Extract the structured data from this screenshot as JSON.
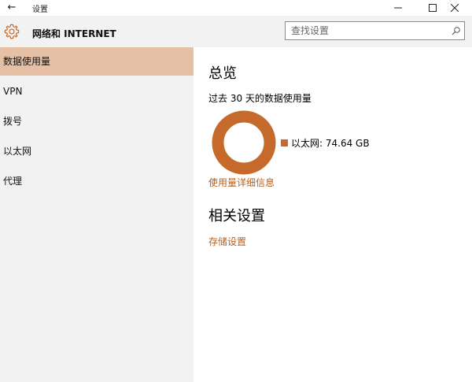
{
  "window": {
    "title": "设置",
    "back_glyph": "←"
  },
  "header": {
    "title": "网络和 INTERNET",
    "search_placeholder": "查找设置"
  },
  "sidebar": {
    "items": [
      {
        "label": "数据使用量",
        "selected": true
      },
      {
        "label": "VPN",
        "selected": false
      },
      {
        "label": "拨号",
        "selected": false
      },
      {
        "label": "以太网",
        "selected": false
      },
      {
        "label": "代理",
        "selected": false
      }
    ]
  },
  "content": {
    "overview_heading": "总览",
    "usage_period_label": "过去 30 天的数据使用量",
    "legend_label": "以太网: 74.64 GB",
    "ethernet_share": 1.0,
    "detail_link": "使用量详细信息",
    "related_heading": "相关设置",
    "storage_link": "存储设置"
  },
  "colors": {
    "accent": "#c56a2b",
    "link": "#b8601f",
    "selected_bg": "#e6c0a4",
    "sidebar_bg": "#f2f2f2"
  }
}
